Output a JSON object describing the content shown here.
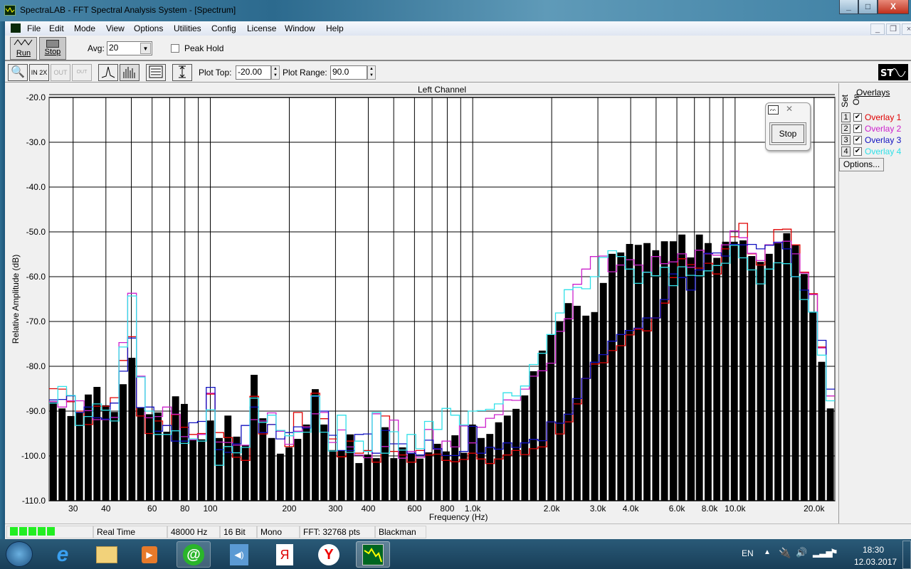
{
  "window": {
    "title": "SpectraLAB - FFT Spectral Analysis System - [Spectrum]"
  },
  "menu": [
    "File",
    "Edit",
    "Mode",
    "View",
    "Options",
    "Utilities",
    "Config",
    "License",
    "Window",
    "Help"
  ],
  "toolbar": {
    "run_label": "Run",
    "stop_label": "Stop",
    "avg_label": "Avg:",
    "avg_value": "20",
    "peak_hold_label": "Peak Hold",
    "peak_hold_checked": false,
    "plot_top_label": "Plot Top:",
    "plot_top_value": "-20.00",
    "plot_range_label": "Plot Range:",
    "plot_range_value": "90.0",
    "zoom_in_label": "IN 2X",
    "zoom_out_label": "OUT 2X",
    "zoom_full_label": "OUT FULL"
  },
  "floating": {
    "stop_label": "Stop"
  },
  "overlays": {
    "title": "Overlays",
    "set_label": "Set",
    "on_label": "On",
    "items": [
      {
        "set": "1",
        "label": "Overlay 1",
        "color": "#e00000",
        "on": true
      },
      {
        "set": "2",
        "label": "Overlay 2",
        "color": "#cc22cc",
        "on": true
      },
      {
        "set": "3",
        "label": "Overlay 3",
        "color": "#1010c0",
        "on": true
      },
      {
        "set": "4",
        "label": "Overlay 4",
        "color": "#30e0e8",
        "on": true
      }
    ],
    "options_label": "Options..."
  },
  "status": {
    "level_segments": 5,
    "mode": "Real Time",
    "rate": "48000 Hz",
    "bits": "16 Bit",
    "channels": "Mono",
    "fft": "FFT: 32768 pts",
    "window": "Blackman"
  },
  "taskbar": {
    "lang": "EN",
    "time": "18:30",
    "date": "12.03.2017"
  },
  "chart_data": {
    "type": "bar",
    "title": "Left Channel",
    "xlabel": "Frequency (Hz)",
    "ylabel": "Relative Amplitude (dB)",
    "xscale": "log",
    "xlim": [
      24.3,
      24000
    ],
    "ylim": [
      -110,
      -20
    ],
    "grid": true,
    "y_ticks": [
      "-20.0",
      "-30.0",
      "-40.0",
      "-50.0",
      "-60.0",
      "-70.0",
      "-80.0",
      "-90.0",
      "-100.0",
      "-110.0"
    ],
    "x_ticks": [
      {
        "v": 30,
        "label": "30"
      },
      {
        "v": 40,
        "label": "40"
      },
      {
        "v": 60,
        "label": "60"
      },
      {
        "v": 80,
        "label": "80"
      },
      {
        "v": 100,
        "label": "100"
      },
      {
        "v": 200,
        "label": "200"
      },
      {
        "v": 300,
        "label": "300"
      },
      {
        "v": 400,
        "label": "400"
      },
      {
        "v": 600,
        "label": "600"
      },
      {
        "v": 800,
        "label": "800"
      },
      {
        "v": 1000,
        "label": "1.0k"
      },
      {
        "v": 2000,
        "label": "2.0k"
      },
      {
        "v": 3000,
        "label": "3.0k"
      },
      {
        "v": 4000,
        "label": "4.0k"
      },
      {
        "v": 6000,
        "label": "6.0k"
      },
      {
        "v": 8000,
        "label": "8.0k"
      },
      {
        "v": 10000,
        "label": "10.0k"
      },
      {
        "v": 20000,
        "label": "20.0k"
      }
    ],
    "bars": [
      -87.9,
      -89.4,
      -91.1,
      -90.3,
      -86.3,
      -84.6,
      -88.7,
      -90.2,
      -84.0,
      -78.1,
      -89.2,
      -90.7,
      -90.3,
      -94.6,
      -86.7,
      -88.4,
      -96.5,
      -96.3,
      -92.1,
      -96.0,
      -91.0,
      -95.7,
      -97.6,
      -81.9,
      -91.6,
      -96.0,
      -99.5,
      -98.1,
      -96.2,
      -93.0,
      -85.1,
      -93.0,
      -98.7,
      -98.9,
      -95.2,
      -101.6,
      -99.7,
      -100.5,
      -93.6,
      -100.5,
      -98.1,
      -99.5,
      -100.6,
      -99.2,
      -97.3,
      -99.0,
      -95.4,
      -99.3,
      -93.0,
      -96.0,
      -95.1,
      -92.5,
      -91.0,
      -89.5,
      -86.5,
      -81.1,
      -76.5,
      -73.0,
      -70.0,
      -65.9,
      -66.5,
      -68.7,
      -67.9,
      -61.4,
      -54.9,
      -54.6,
      -52.7,
      -52.9,
      -52.5,
      -54.1,
      -52.1,
      -52.1,
      -50.6,
      -55.7,
      -50.6,
      -52.5,
      -55.8,
      -52.2,
      -52.2,
      -51.9,
      -55.4,
      -56.7,
      -54.9,
      -52.5,
      -50.3,
      -52.9,
      -59.4,
      -67.8,
      -79.0,
      -89.4
    ],
    "series": [
      {
        "name": "Overlay 1",
        "color": "#e00000",
        "values": [
          -85.0,
          -85.1,
          -87.9,
          -90.0,
          -93.0,
          -88.9,
          -88.9,
          -87.0,
          -78.7,
          -73.4,
          -91.1,
          -95.0,
          -92.2,
          -93.2,
          -90.8,
          -93.6,
          -95.2,
          -95.0,
          -86.2,
          -94.8,
          -95.9,
          -100.3,
          -101.0,
          -86.7,
          -95.1,
          -93.0,
          -94.3,
          -97.9,
          -90.3,
          -93.5,
          -86.0,
          -91.7,
          -96.2,
          -100.2,
          -96.7,
          -99.4,
          -98.8,
          -101.4,
          -91.1,
          -99.0,
          -99.8,
          -101.4,
          -98.8,
          -99.8,
          -99.6,
          -101.0,
          -101.3,
          -100.8,
          -99.4,
          -100.7,
          -101.7,
          -100.7,
          -99.8,
          -98.8,
          -99.7,
          -98.4,
          -98.0,
          -92.4,
          -95.1,
          -92.4,
          -88.4,
          -82.7,
          -79.5,
          -79.2,
          -76.5,
          -75.4,
          -73.0,
          -71.7,
          -72.1,
          -69.2,
          -65.9,
          -60.2,
          -56.0,
          -57.3,
          -58.1,
          -57.0,
          -59.4,
          -53.8,
          -51.1,
          -48.1,
          -54.9,
          -57.4,
          -52.9,
          -49.5,
          -49.4,
          -52.9,
          -59.0,
          -63.8,
          -75.7,
          -86.6
        ]
      },
      {
        "name": "Overlay 2",
        "color": "#cc22cc",
        "values": [
          -87.9,
          -89.1,
          -87.7,
          -87.7,
          -89.9,
          -91.9,
          -91.9,
          -91.4,
          -74.7,
          -63.7,
          -82.2,
          -91.5,
          -91.2,
          -89.1,
          -90.7,
          -95.7,
          -96.4,
          -95.2,
          -86.0,
          -96.9,
          -97.0,
          -97.6,
          -97.6,
          -91.9,
          -92.2,
          -90.4,
          -94.5,
          -97.4,
          -94.5,
          -93.5,
          -90.6,
          -90.3,
          -97.0,
          -94.2,
          -98.0,
          -99.8,
          -100.4,
          -90.6,
          -97.9,
          -92.0,
          -100.5,
          -99.0,
          -100.3,
          -94.1,
          -98.5,
          -96.7,
          -98.0,
          -93.3,
          -97.1,
          -93.6,
          -91.6,
          -90.8,
          -87.5,
          -87.6,
          -85.1,
          -82.2,
          -81.0,
          -79.3,
          -72.2,
          -69.4,
          -61.7,
          -58.3,
          -55.5,
          -55.4,
          -58.9,
          -57.4,
          -56.2,
          -57.4,
          -59.0,
          -55.5,
          -57.1,
          -56.7,
          -54.9,
          -57.9,
          -54.1,
          -54.9,
          -55.2,
          -52.9,
          -49.8,
          -51.3,
          -54.8,
          -56.4,
          -52.9,
          -52.4,
          -52.1,
          -54.9,
          -59.2,
          -64.0,
          -75.9,
          -86.6
        ]
      },
      {
        "name": "Overlay 3",
        "color": "#1010c0",
        "values": [
          -87.5,
          -87.4,
          -86.6,
          -90.3,
          -89.1,
          -91.5,
          -91.8,
          -88.2,
          -81.1,
          -73.7,
          -89.2,
          -89.1,
          -94.5,
          -93.2,
          -96.7,
          -96.7,
          -92.6,
          -92.3,
          -84.7,
          -98.6,
          -99.2,
          -97.3,
          -93.2,
          -89.1,
          -94.8,
          -93.0,
          -96.2,
          -94.8,
          -93.5,
          -93.8,
          -86.7,
          -90.0,
          -95.4,
          -98.8,
          -98.8,
          -95.2,
          -95.1,
          -99.4,
          -94.3,
          -97.3,
          -97.3,
          -99.4,
          -99.8,
          -96.5,
          -98.4,
          -99.9,
          -99.9,
          -99.0,
          -93.4,
          -99.4,
          -98.1,
          -98.5,
          -97.1,
          -98.1,
          -97.1,
          -96.3,
          -96.6,
          -92.4,
          -92.7,
          -90.7,
          -87.2,
          -82.7,
          -79.1,
          -77.4,
          -74.4,
          -72.9,
          -72.0,
          -71.5,
          -69.2,
          -69.2,
          -65.1,
          -59.4,
          -60.2,
          -63.0,
          -58.5,
          -54.8,
          -54.7,
          -55.4,
          -52.8,
          -52.9,
          -52.8,
          -53.8,
          -53.0,
          -52.3,
          -53.8,
          -60.0,
          -63.0,
          -67.9,
          -74.2,
          -85.1
        ]
      },
      {
        "name": "Overlay 4",
        "color": "#30e0e8",
        "values": [
          -88.2,
          -84.5,
          -86.5,
          -93.2,
          -91.2,
          -88.4,
          -89.8,
          -92.2,
          -75.7,
          -64.3,
          -82.4,
          -90.0,
          -95.2,
          -95.2,
          -94.4,
          -97.2,
          -96.2,
          -96.7,
          -89.7,
          -102.1,
          -97.9,
          -99.3,
          -98.1,
          -87.1,
          -92.5,
          -90.9,
          -94.3,
          -95.5,
          -94.7,
          -94.7,
          -86.6,
          -94.7,
          -98.9,
          -90.9,
          -99.2,
          -96.7,
          -99.0,
          -90.3,
          -99.4,
          -94.6,
          -98.7,
          -95.2,
          -98.4,
          -92.3,
          -94.1,
          -89.4,
          -90.9,
          -93.1,
          -90.0,
          -89.9,
          -89.6,
          -88.4,
          -85.9,
          -86.6,
          -84.4,
          -79.6,
          -77.1,
          -72.9,
          -68.1,
          -62.9,
          -62.4,
          -62.7,
          -60.0,
          -55.7,
          -54.2,
          -55.5,
          -58.3,
          -61.5,
          -59.0,
          -59.8,
          -57.9,
          -62.0,
          -57.8,
          -59.7,
          -59.8,
          -58.7,
          -57.5,
          -57.0,
          -53.0,
          -55.8,
          -58.5,
          -61.6,
          -58.3,
          -56.9,
          -57.1,
          -60.0,
          -65.1,
          -67.9,
          -77.5,
          -87.7
        ]
      }
    ]
  }
}
